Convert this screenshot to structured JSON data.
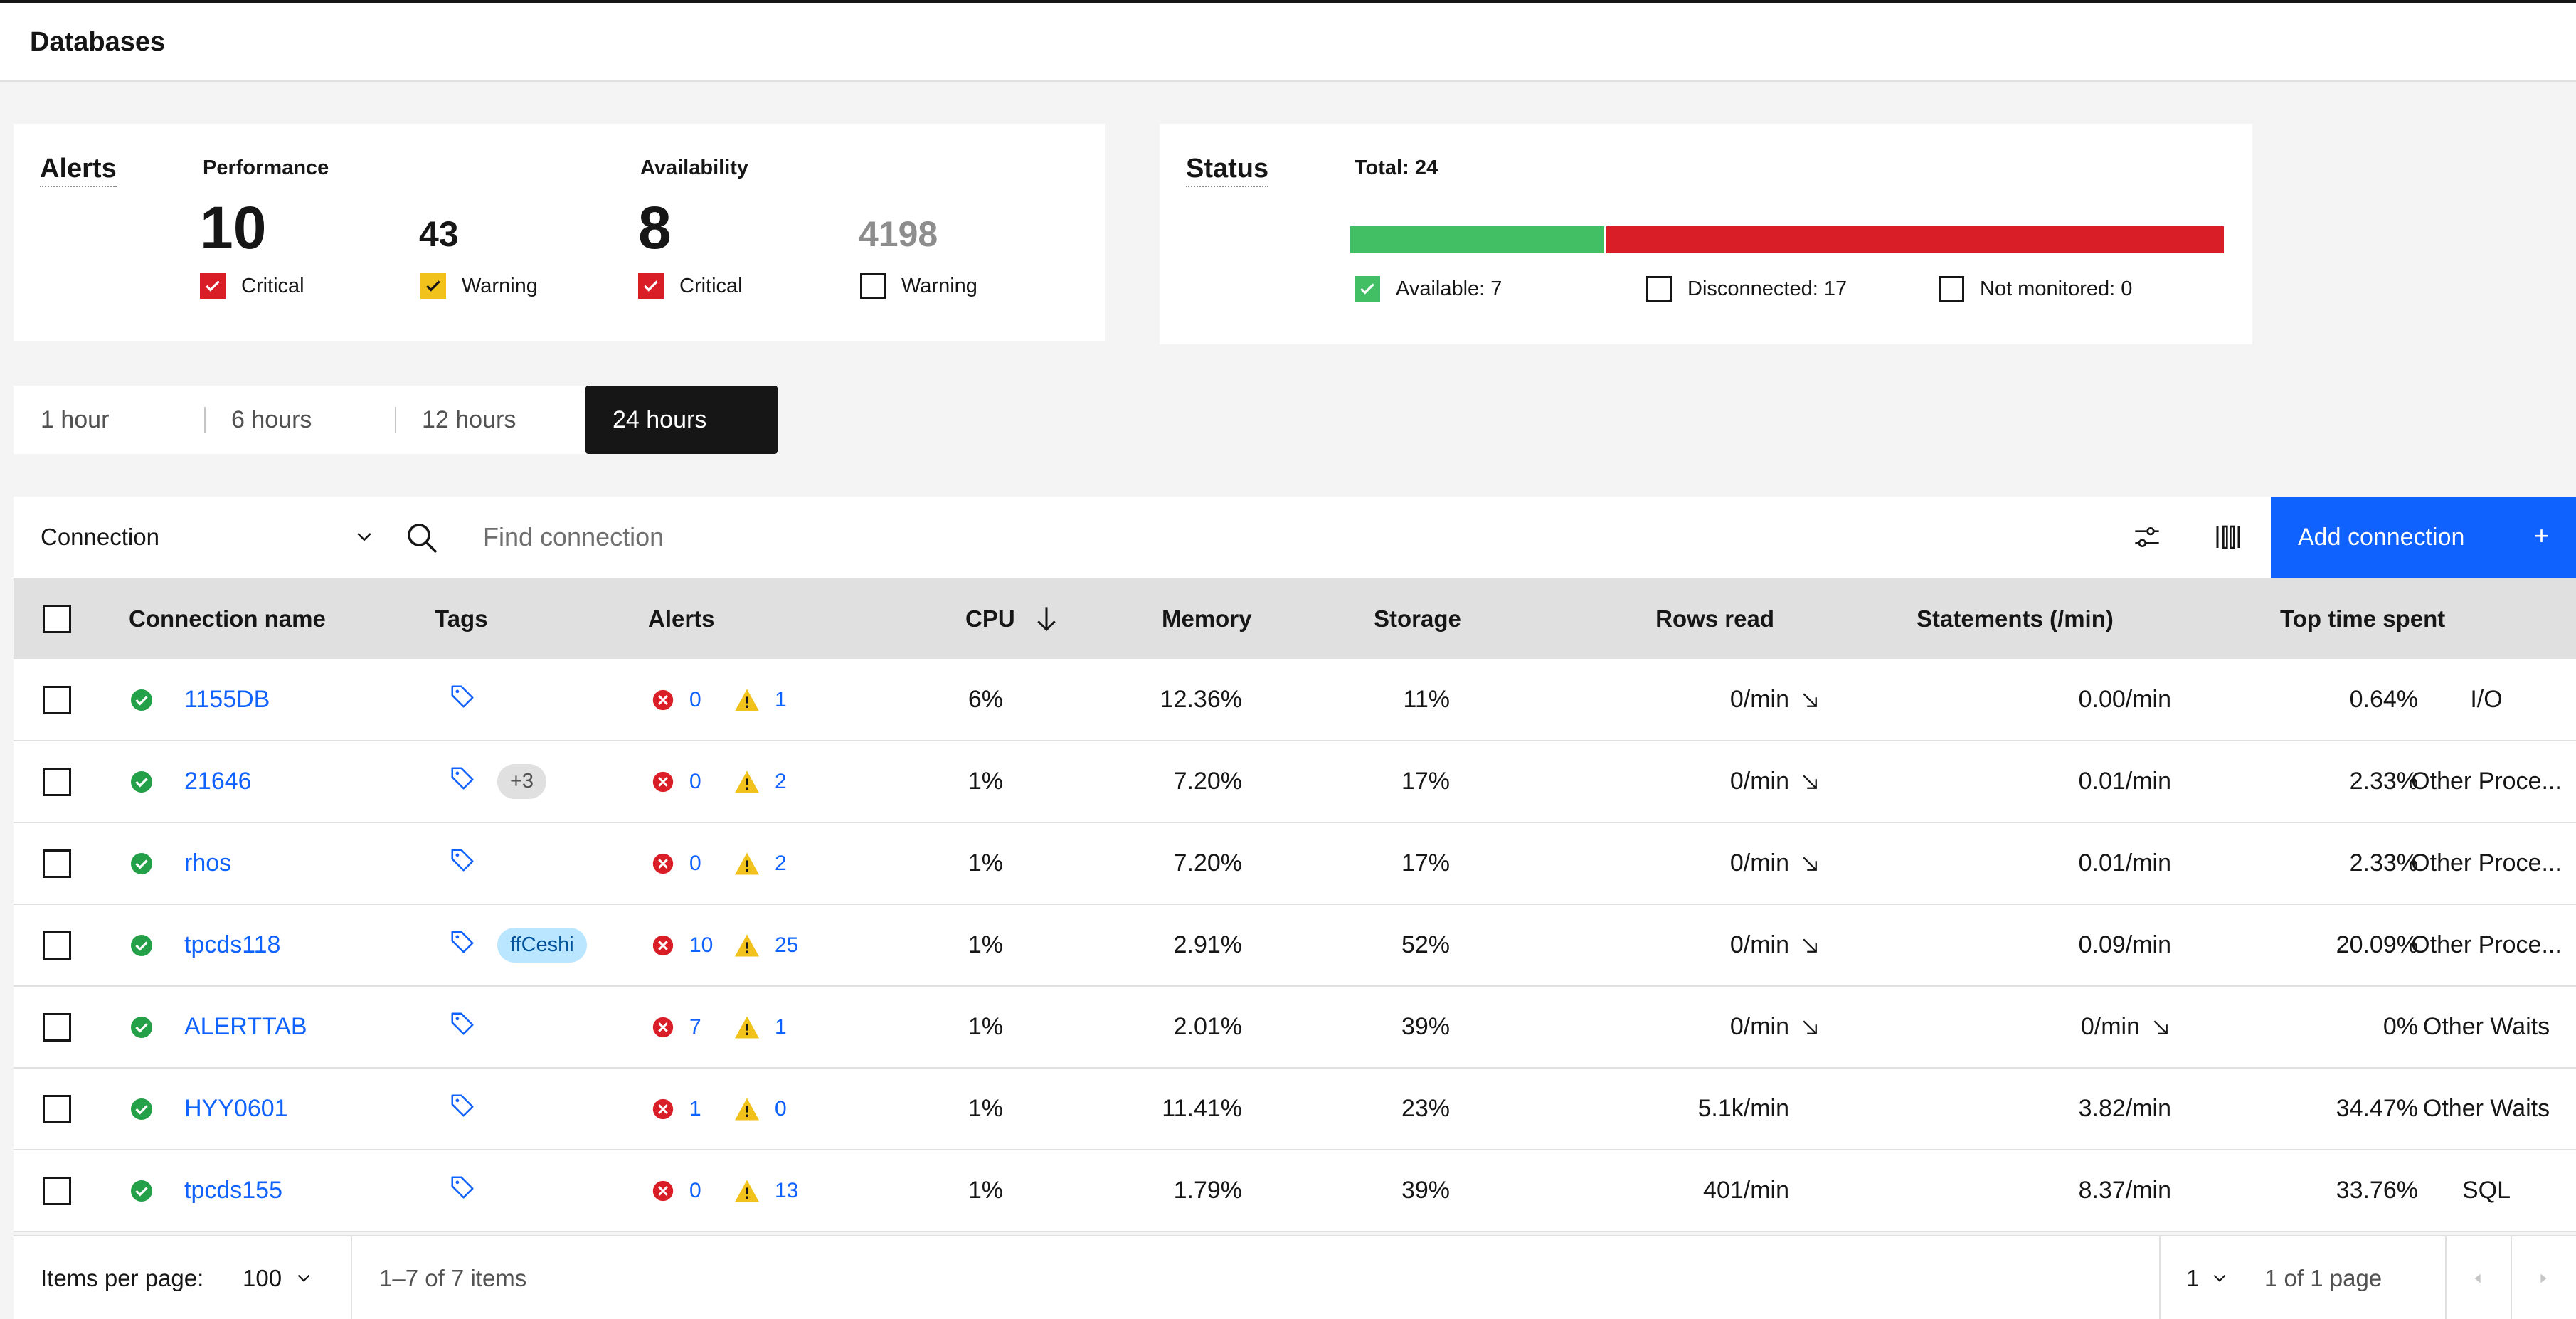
{
  "header": {
    "title": "Databases"
  },
  "alerts": {
    "title": "Alerts",
    "performance": {
      "title": "Performance",
      "critical_value": "10",
      "critical_label": "Critical",
      "warning_value": "43",
      "warning_label": "Warning"
    },
    "availability": {
      "title": "Availability",
      "critical_value": "8",
      "critical_label": "Critical",
      "warning_value": "4198",
      "warning_label": "Warning"
    }
  },
  "status": {
    "title": "Status",
    "total": "Total: 24",
    "available": 7,
    "disconnected": 17,
    "not_monitored": 0,
    "available_label": "Available: 7",
    "disconnected_label": "Disconnected: 17",
    "not_monitored_label": "Not monitored: 0",
    "colors": {
      "available": "#42be65",
      "disconnected": "#da1e28"
    }
  },
  "time_range": {
    "tabs": [
      "1 hour",
      "6 hours",
      "12 hours",
      "24 hours"
    ],
    "selected": "24 hours"
  },
  "toolbar": {
    "filter_select": "Connection",
    "search_placeholder": "Find connection",
    "add_button": "Add connection",
    "add_icon": "+"
  },
  "table": {
    "columns": [
      "Connection name",
      "Tags",
      "Alerts",
      "CPU",
      "Memory",
      "Storage",
      "Rows read",
      "Statements (/min)",
      "Top time spent"
    ],
    "sort_column": "CPU",
    "sort_direction": "descending",
    "rows": [
      {
        "name": "1155DB",
        "tag_pill": "",
        "critical": "0",
        "warning": "1",
        "cpu": "6%",
        "memory": "12.36%",
        "storage": "11%",
        "rows_read": "0/min",
        "rows_trend": true,
        "statements": "0.00/min",
        "stmt_trend": false,
        "top_pct": "0.64%",
        "top_type": "I/O"
      },
      {
        "name": "21646",
        "tag_pill": "+3",
        "critical": "0",
        "warning": "2",
        "cpu": "1%",
        "memory": "7.20%",
        "storage": "17%",
        "rows_read": "0/min",
        "rows_trend": true,
        "statements": "0.01/min",
        "stmt_trend": false,
        "top_pct": "2.33%",
        "top_type": "Other Proce..."
      },
      {
        "name": "rhos",
        "tag_pill": "",
        "critical": "0",
        "warning": "2",
        "cpu": "1%",
        "memory": "7.20%",
        "storage": "17%",
        "rows_read": "0/min",
        "rows_trend": true,
        "statements": "0.01/min",
        "stmt_trend": false,
        "top_pct": "2.33%",
        "top_type": "Other Proce..."
      },
      {
        "name": "tpcds118",
        "tag_pill": "ffCeshi",
        "critical": "10",
        "warning": "25",
        "cpu": "1%",
        "memory": "2.91%",
        "storage": "52%",
        "rows_read": "0/min",
        "rows_trend": true,
        "statements": "0.09/min",
        "stmt_trend": false,
        "top_pct": "20.09%",
        "top_type": "Other Proce..."
      },
      {
        "name": "ALERTTAB",
        "tag_pill": "",
        "critical": "7",
        "warning": "1",
        "cpu": "1%",
        "memory": "2.01%",
        "storage": "39%",
        "rows_read": "0/min",
        "rows_trend": true,
        "statements": "0/min",
        "stmt_trend": true,
        "top_pct": "0%",
        "top_type": "Other Waits"
      },
      {
        "name": "HYY0601",
        "tag_pill": "",
        "critical": "1",
        "warning": "0",
        "cpu": "1%",
        "memory": "11.41%",
        "storage": "23%",
        "rows_read": "5.1k/min",
        "rows_trend": false,
        "statements": "3.82/min",
        "stmt_trend": false,
        "top_pct": "34.47%",
        "top_type": "Other Waits"
      },
      {
        "name": "tpcds155",
        "tag_pill": "",
        "critical": "0",
        "warning": "13",
        "cpu": "1%",
        "memory": "1.79%",
        "storage": "39%",
        "rows_read": "401/min",
        "rows_trend": false,
        "statements": "8.37/min",
        "stmt_trend": false,
        "top_pct": "33.76%",
        "top_type": "SQL"
      }
    ]
  },
  "pagination": {
    "items_per_page_label": "Items per page:",
    "items_per_page": "100",
    "range": "1–7 of 7 items",
    "page": "1",
    "page_info": "1 of 1 page"
  }
}
